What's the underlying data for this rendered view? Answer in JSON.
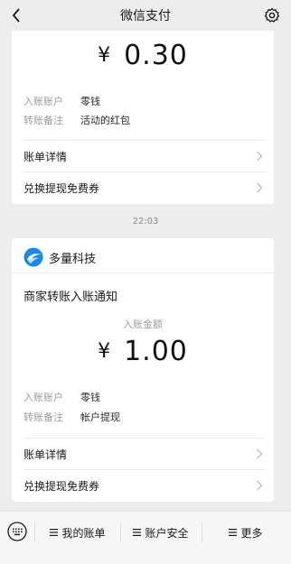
{
  "nav": {
    "title": "微信支付",
    "back_icon": "chevron-left-icon",
    "settings_icon": "gear-icon"
  },
  "message1": {
    "currency": "¥",
    "amount": "0.30",
    "fields": [
      {
        "key": "入账账户",
        "value": "零钱"
      },
      {
        "key": "转账备注",
        "value": "活动的红包"
      }
    ],
    "links": [
      "账单详情",
      "兑换提现免费券"
    ]
  },
  "timestamp": "22:03",
  "message2": {
    "merchant_name": "多量科技",
    "merchant_logo_color": "#1e88e5",
    "title": "商家转账入账通知",
    "amount_label": "入账金额",
    "currency": "¥",
    "amount": "1.00",
    "fields": [
      {
        "key": "入账账户",
        "value": "零钱"
      },
      {
        "key": "转账备注",
        "value": "帐户提现"
      }
    ],
    "links": [
      "账单详情",
      "兑换提现免费券"
    ]
  },
  "bottombar": {
    "keyboard_icon": "keyboard-icon",
    "tabs": [
      "我的账单",
      "账户安全",
      "更多"
    ]
  }
}
